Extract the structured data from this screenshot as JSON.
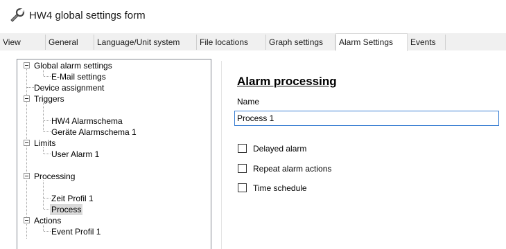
{
  "window": {
    "title": "HW4 global settings form",
    "icon": "tools-icon"
  },
  "tabs": [
    {
      "label": "View",
      "active": false
    },
    {
      "label": "General",
      "active": false
    },
    {
      "label": "Language/Unit system",
      "active": false
    },
    {
      "label": "File locations",
      "active": false
    },
    {
      "label": "Graph settings",
      "active": false
    },
    {
      "label": "Alarm Settings",
      "active": true
    },
    {
      "label": "Events",
      "active": false
    }
  ],
  "tree": {
    "nodes": [
      {
        "label": "Global alarm settings",
        "level": 0,
        "expanded": true
      },
      {
        "label": "E-Mail settings",
        "level": 1
      },
      {
        "label": "Device assignment",
        "level": 0
      },
      {
        "label": "Triggers",
        "level": 0,
        "expanded": true
      },
      {
        "label": "HW4 Alarmschema",
        "level": 1
      },
      {
        "label": "Geräte Alarmschema 1",
        "level": 1
      },
      {
        "label": "Limits",
        "level": 0,
        "expanded": true
      },
      {
        "label": "User Alarm 1",
        "level": 1
      },
      {
        "label": "Processing",
        "level": 0,
        "expanded": true
      },
      {
        "label": "Zeit Profil 1",
        "level": 1
      },
      {
        "label": "Process",
        "level": 1,
        "selected": true
      },
      {
        "label": "Actions",
        "level": 0,
        "expanded": true
      },
      {
        "label": "Event Profil 1",
        "level": 1
      }
    ]
  },
  "panel": {
    "heading": "Alarm processing",
    "name_label": "Name",
    "name_value": "Process 1",
    "checkboxes": [
      {
        "label": "Delayed alarm",
        "checked": false
      },
      {
        "label": "Repeat alarm actions",
        "checked": false
      },
      {
        "label": "Time schedule",
        "checked": false
      }
    ]
  },
  "colors": {
    "input_focus_border": "#3a7fd3",
    "selection_background": "#d9d9d9",
    "tabstrip_background": "#f0f0f0"
  }
}
